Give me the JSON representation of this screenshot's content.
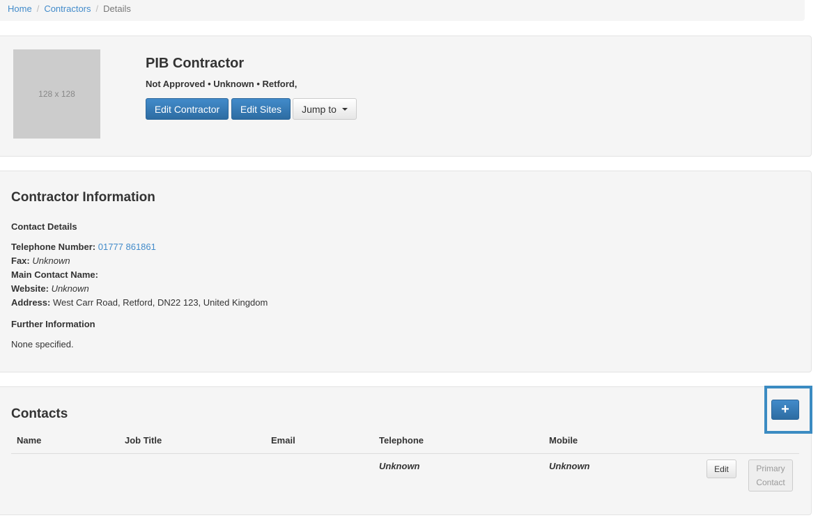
{
  "breadcrumb": {
    "items": [
      "Home",
      "Contractors",
      "Details"
    ],
    "separator": "/"
  },
  "header": {
    "thumbnail_placeholder": "128 x 128",
    "title": "PIB Contractor",
    "subtitle": "Not Approved • Unknown • Retford,",
    "buttons": {
      "edit_contractor": "Edit Contractor",
      "edit_sites": "Edit Sites",
      "jump_to": "Jump to"
    }
  },
  "info": {
    "heading": "Contractor Information",
    "contact_heading": "Contact Details",
    "telephone_label": "Telephone Number:",
    "telephone_value": "01777 861861",
    "fax_label": "Fax:",
    "fax_value": "Unknown",
    "main_contact_label": "Main Contact Name:",
    "main_contact_value": "",
    "website_label": "Website:",
    "website_value": "Unknown",
    "address_label": "Address:",
    "address_value": "West Carr Road, Retford, DN22 123, United Kingdom",
    "further_heading": "Further Information",
    "further_value": "None specified."
  },
  "contacts": {
    "heading": "Contacts",
    "add_label": "+",
    "columns": [
      "Name",
      "Job Title",
      "Email",
      "Telephone",
      "Mobile"
    ],
    "rows": [
      {
        "name": "",
        "job_title": "",
        "email": "",
        "telephone": "Unknown",
        "mobile": "Unknown",
        "edit_label": "Edit",
        "primary_label": "Primary Contact"
      }
    ]
  },
  "colors": {
    "primary": "#428bca",
    "link": "#428bca",
    "panel_bg": "#f5f5f5",
    "highlight": "#3b8bc2"
  }
}
